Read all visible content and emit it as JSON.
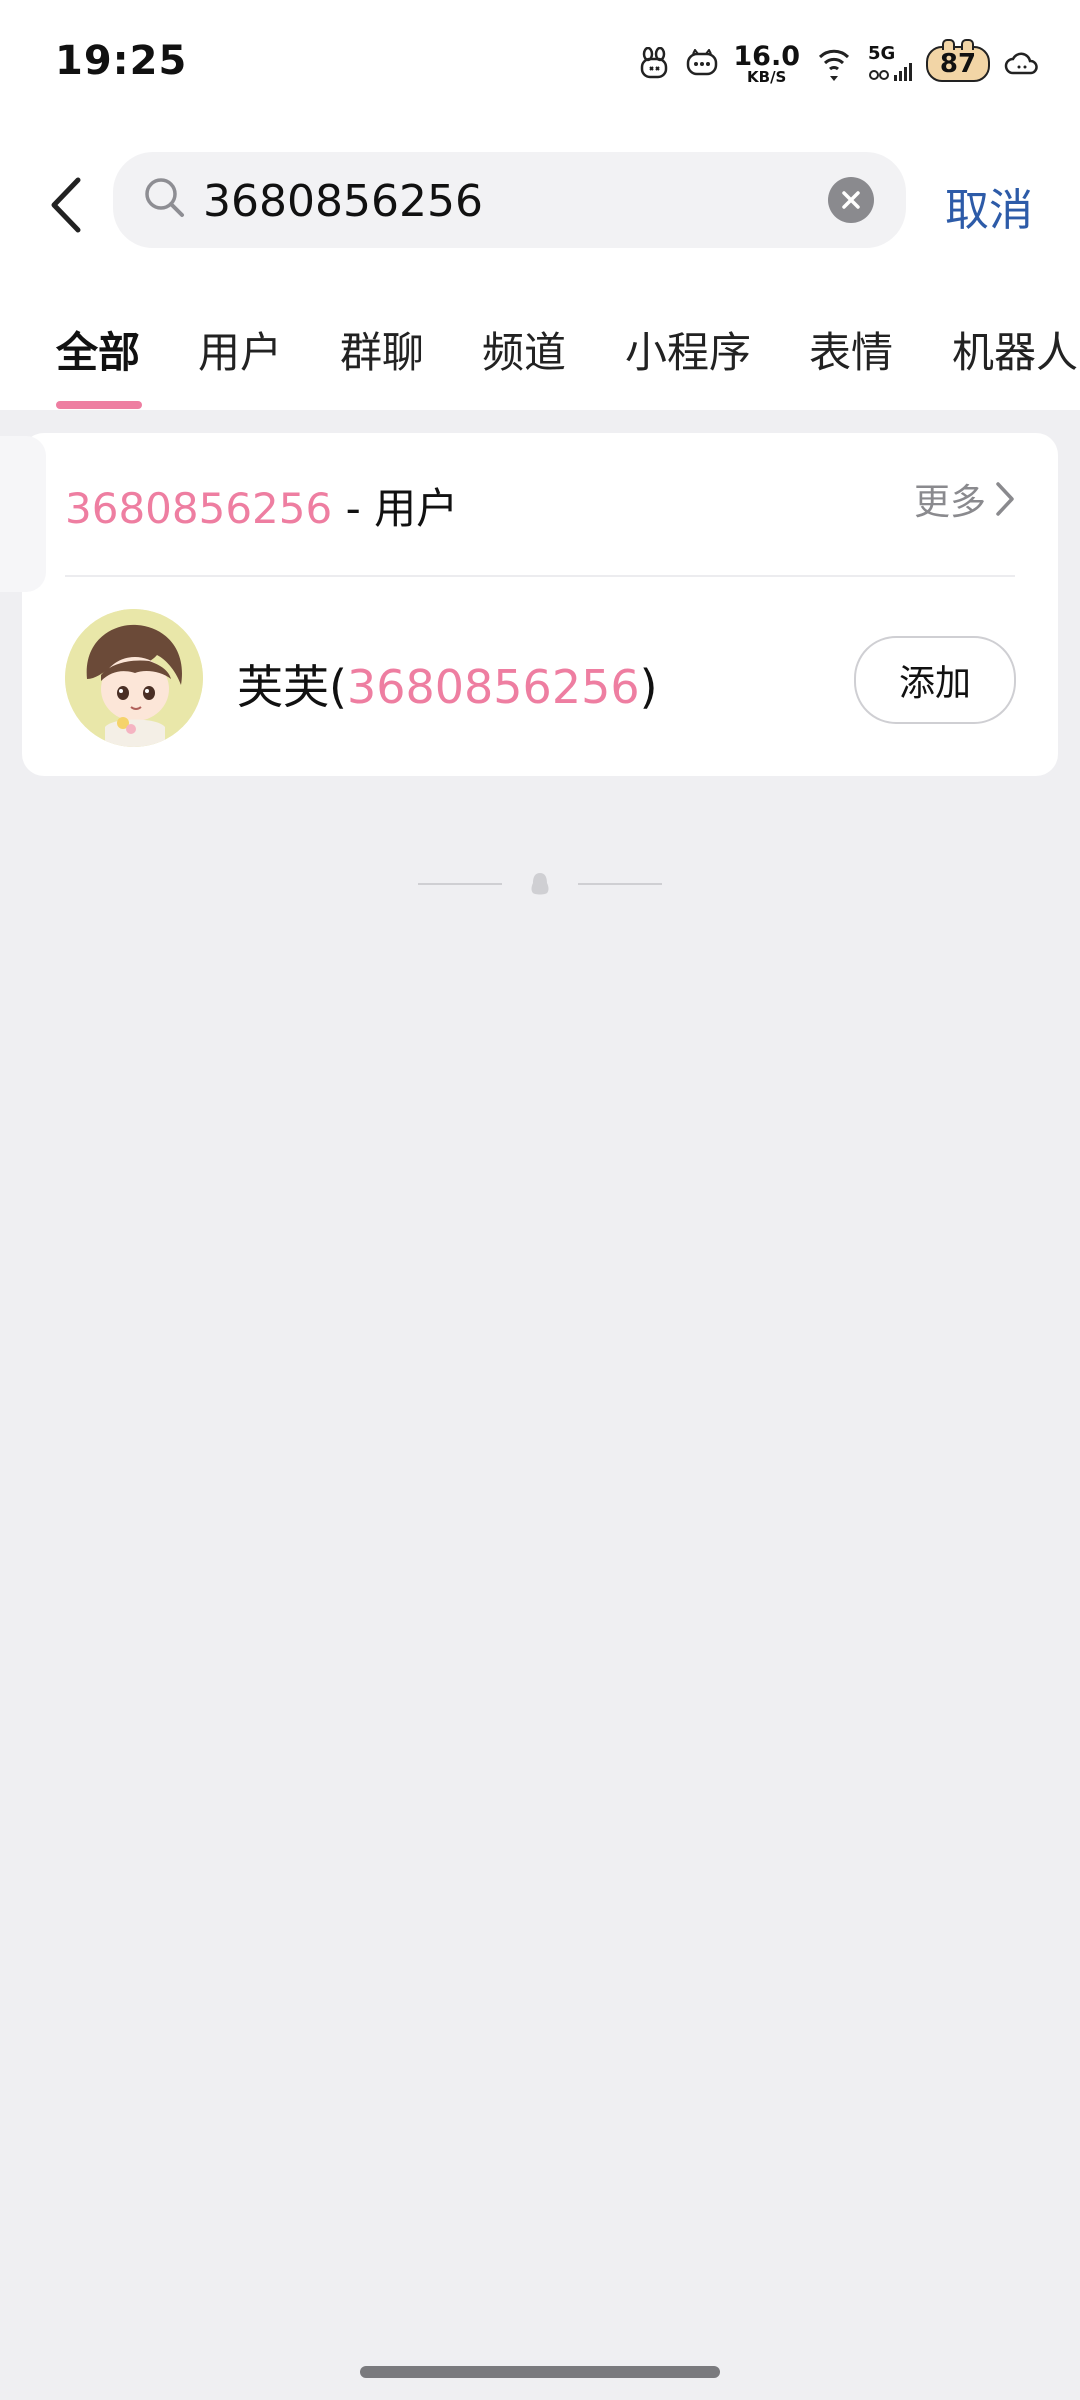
{
  "status_bar": {
    "time": "19:25",
    "network_speed_value": "16.0",
    "network_speed_unit": "KB/S",
    "network_type": "5G",
    "battery_level": "87",
    "icons": [
      "bunny-icon",
      "chat-bubble-icon",
      "wifi-icon",
      "cellular-icon",
      "battery-icon",
      "cloud-icon"
    ]
  },
  "search": {
    "value": "3680856256",
    "cancel_label": "取消"
  },
  "tabs": [
    {
      "label": "全部",
      "active": true
    },
    {
      "label": "用户",
      "active": false
    },
    {
      "label": "群聊",
      "active": false
    },
    {
      "label": "频道",
      "active": false
    },
    {
      "label": "小程序",
      "active": false
    },
    {
      "label": "表情",
      "active": false
    },
    {
      "label": "机器人",
      "active": false
    }
  ],
  "results": {
    "section_id": "3680856256",
    "section_suffix": " - 用户",
    "more_label": "更多",
    "user": {
      "name_prefix": "芙芙(",
      "id": "3680856256",
      "name_suffix": ")",
      "add_label": "添加"
    }
  },
  "colors": {
    "accent_pink": "#EE7EA1",
    "cancel_blue": "#2D5BA8",
    "background": "#EFEFF2"
  }
}
